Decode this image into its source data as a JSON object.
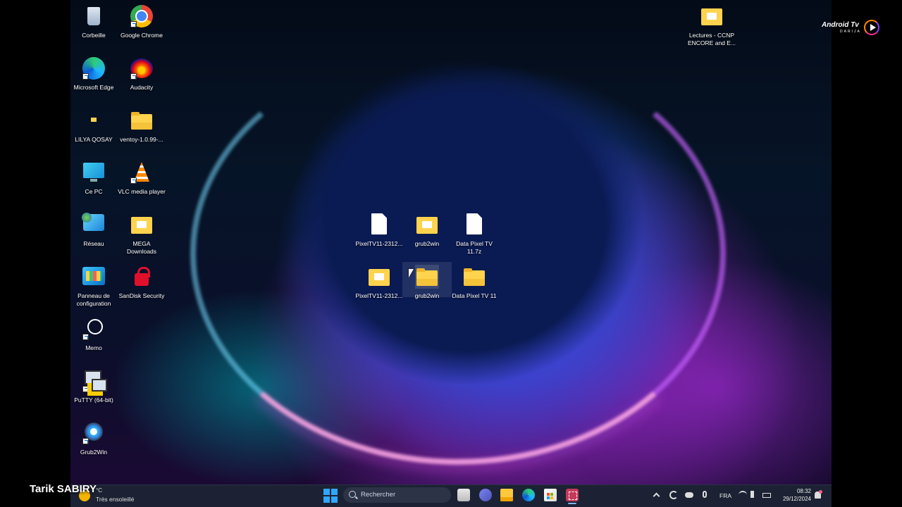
{
  "desktop": {
    "left_icons": [
      {
        "label": "Corbeille",
        "icon": "recycle-bin-icon"
      },
      {
        "label": "Google Chrome",
        "icon": "chrome-icon"
      },
      {
        "label": "Microsoft Edge",
        "icon": "edge-icon"
      },
      {
        "label": "Audacity",
        "icon": "audacity-icon"
      },
      {
        "label": "LILYA QOSAY",
        "icon": "folder-icon"
      },
      {
        "label": "ventoy-1.0.99-...",
        "icon": "folder-icon"
      },
      {
        "label": "Ce PC",
        "icon": "computer-icon"
      },
      {
        "label": "VLC media player",
        "icon": "vlc-icon"
      },
      {
        "label": "Réseau",
        "icon": "network-icon"
      },
      {
        "label": "MEGA\nDownloads",
        "icon": "folder-icon"
      },
      {
        "label": "Panneau de\nconfiguration",
        "icon": "control-panel-icon"
      },
      {
        "label": "SanDisk Security",
        "icon": "lock-icon"
      },
      {
        "label": "Memo",
        "icon": "memo-icon"
      },
      {
        "label": "PuTTY (64-bit)",
        "icon": "putty-icon"
      },
      {
        "label": "Grub2Win",
        "icon": "grub2win-icon"
      }
    ],
    "center_icons": [
      {
        "label": "PixelTV11-2312...",
        "icon": "file-icon"
      },
      {
        "label": "grub2win",
        "icon": "folder-icon"
      },
      {
        "label": "Data Pixel TV\n11.7z",
        "icon": "file-icon"
      },
      {
        "label": "PixelTV11-2312...",
        "icon": "folder-icon"
      },
      {
        "label": "grub2win",
        "icon": "folder-icon"
      },
      {
        "label": "Data Pixel TV 11",
        "icon": "folder-icon"
      }
    ],
    "top_right_icon": {
      "label": "Lectures - CCNP\nENCORE and E...",
      "icon": "folder-icon"
    }
  },
  "watermark": {
    "brand": "Android Tv",
    "sub": "DARIJA"
  },
  "overlay": {
    "name": "Tarik SABIRY"
  },
  "taskbar": {
    "weather": {
      "temp": "°C",
      "desc": "Très ensoleillé"
    },
    "search_placeholder": "Rechercher",
    "language": "FRA",
    "time": "08:32",
    "date": "29/12/2024"
  }
}
